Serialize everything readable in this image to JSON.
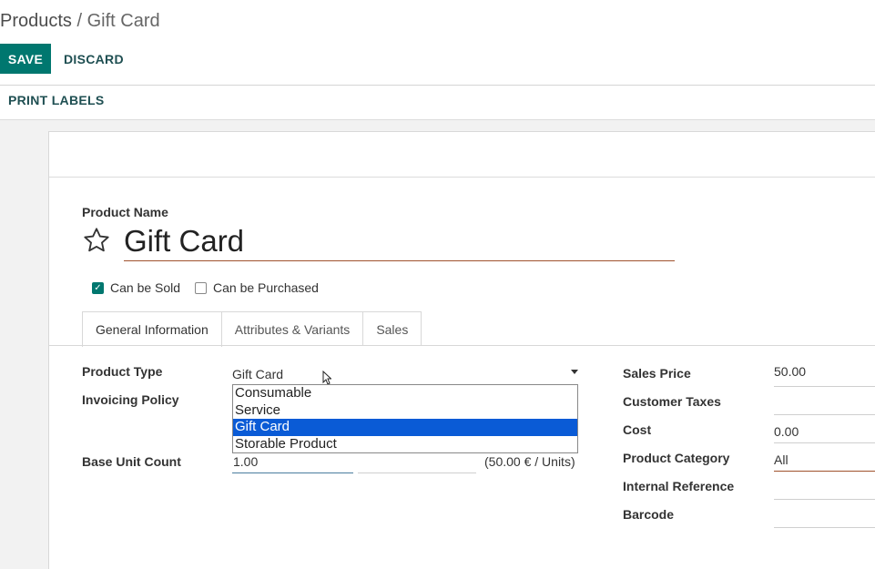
{
  "breadcrumb": {
    "parent": "Products",
    "separator": "/",
    "current": "Gift Card"
  },
  "toolbar": {
    "save_label": "SAVE",
    "discard_label": "DISCARD",
    "print_labels": "PRINT LABELS"
  },
  "form": {
    "name_label": "Product Name",
    "name_value": "Gift Card",
    "can_be_sold": {
      "label": "Can be Sold",
      "checked": true
    },
    "can_be_purchased": {
      "label": "Can be Purchased",
      "checked": false
    },
    "tabs": [
      {
        "label": "General Information",
        "active": true
      },
      {
        "label": "Attributes & Variants",
        "active": false
      },
      {
        "label": "Sales",
        "active": false
      }
    ],
    "left_fields": {
      "product_type": {
        "label": "Product Type",
        "value": "Gift Card"
      },
      "invoicing_policy": {
        "label": "Invoicing Policy"
      },
      "base_unit_count": {
        "label": "Base Unit Count",
        "value": "1.00",
        "suffix": "(50.00 € / Units)"
      }
    },
    "product_type_options": [
      "Consumable",
      "Service",
      "Gift Card",
      "Storable Product"
    ],
    "selected_option": "Gift Card",
    "right_fields": {
      "sales_price": {
        "label": "Sales Price",
        "value": "50.00"
      },
      "customer_taxes": {
        "label": "Customer Taxes",
        "value": ""
      },
      "cost": {
        "label": "Cost",
        "value": "0.00"
      },
      "product_category": {
        "label": "Product Category",
        "value": "All"
      },
      "internal_reference": {
        "label": "Internal Reference",
        "value": ""
      },
      "barcode": {
        "label": "Barcode",
        "value": ""
      }
    }
  },
  "colors": {
    "primary": "#00776f",
    "link": "#1f4f52",
    "selection": "#0a5bd6",
    "required_underline": "#a0522d"
  },
  "icons": [
    "star-icon",
    "checkbox-checked-icon",
    "checkbox-empty-icon",
    "dropdown-caret-icon",
    "mouse-cursor-icon"
  ]
}
